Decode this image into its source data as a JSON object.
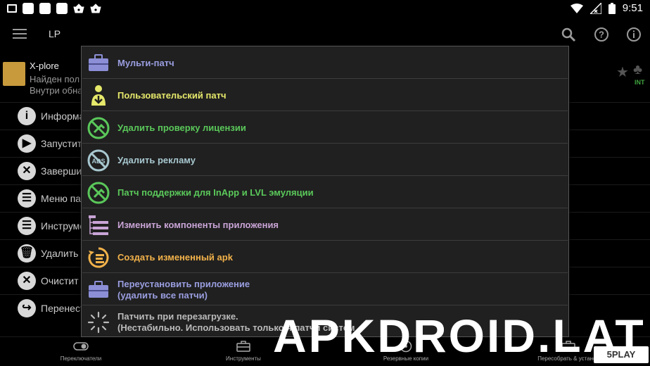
{
  "status_bar": {
    "time": "9:51"
  },
  "appbar": {
    "title": "LP"
  },
  "app_entry": {
    "name": "X-plore",
    "line2": "Найден пол",
    "line3": "Внутри обна",
    "badge": "INT"
  },
  "bg_menu": [
    {
      "label": "Информа",
      "glyph": "i"
    },
    {
      "label": "Запустит",
      "glyph": "▶"
    },
    {
      "label": "Заверши",
      "glyph": "✕"
    },
    {
      "label": "Меню пат",
      "glyph": "☰"
    },
    {
      "label": "Инструме",
      "glyph": "☰"
    },
    {
      "label": "Удалить",
      "glyph": "🗑"
    },
    {
      "label": "Очистит",
      "glyph": "✕"
    },
    {
      "label": "Перенест",
      "glyph": "↪"
    }
  ],
  "dialog": {
    "items": [
      {
        "label": "Мульти-патч",
        "color": "#9a9ee0"
      },
      {
        "label": "Пользовательский патч",
        "color": "#e6e86a"
      },
      {
        "label": "Удалить проверку лицензии",
        "color": "#5ac85a"
      },
      {
        "label": "Удалить рекламу",
        "color": "#a8c8d0"
      },
      {
        "label": "Патч поддержки для InApp и LVL эмуляции",
        "color": "#5ac85a"
      },
      {
        "label": "Изменить компоненты приложения",
        "color": "#c9a4d6"
      },
      {
        "label": "Создать измененный apk",
        "color": "#f2b24a"
      },
      {
        "label": "Переустановить приложение",
        "label2": "(удалить все патчи)",
        "color": "#9a9ee0"
      },
      {
        "label": "Патчить при перезагрузке.",
        "label2": "(Нестабильно. Использовать только",
        "label2b": "я патчи систем",
        "color": "#bbbbbb"
      }
    ]
  },
  "bottom_nav": [
    {
      "label": "Переключатели"
    },
    {
      "label": "Инструменты"
    },
    {
      "label": "Резервные копии"
    },
    {
      "label": "Пересобрать & установ"
    }
  ],
  "watermark": {
    "text": "APKDROID.LAT",
    "badge": "5PLAY"
  }
}
